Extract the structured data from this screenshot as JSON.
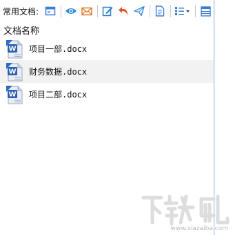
{
  "toolbar": {
    "label": "常用文档:",
    "buttons": [
      {
        "name": "window-icon",
        "color": "#3a7bd5"
      },
      {
        "name": "eye-icon",
        "color": "#2a8ad6"
      },
      {
        "name": "mail-icon",
        "color": "#e07b2a"
      },
      {
        "name": "edit-icon",
        "color": "#2a7fd0"
      },
      {
        "name": "undo-icon",
        "color": "#e0552a"
      },
      {
        "name": "send-icon",
        "color": "#3a8ad6"
      },
      {
        "name": "document-icon",
        "color": "#3a7bd5"
      },
      {
        "name": "view-list-icon",
        "color": "#3a7bd5"
      },
      {
        "name": "grid-icon",
        "color": "#3a7bd5"
      }
    ]
  },
  "list": {
    "header": "文档名称",
    "files": [
      {
        "name": "项目一部.docx",
        "selected": false
      },
      {
        "name": "财务数据.docx",
        "selected": true
      },
      {
        "name": "项目二部.docx",
        "selected": false
      }
    ]
  },
  "watermark": {
    "text": "www.xiazaiba.com",
    "logo": "下载吧"
  }
}
